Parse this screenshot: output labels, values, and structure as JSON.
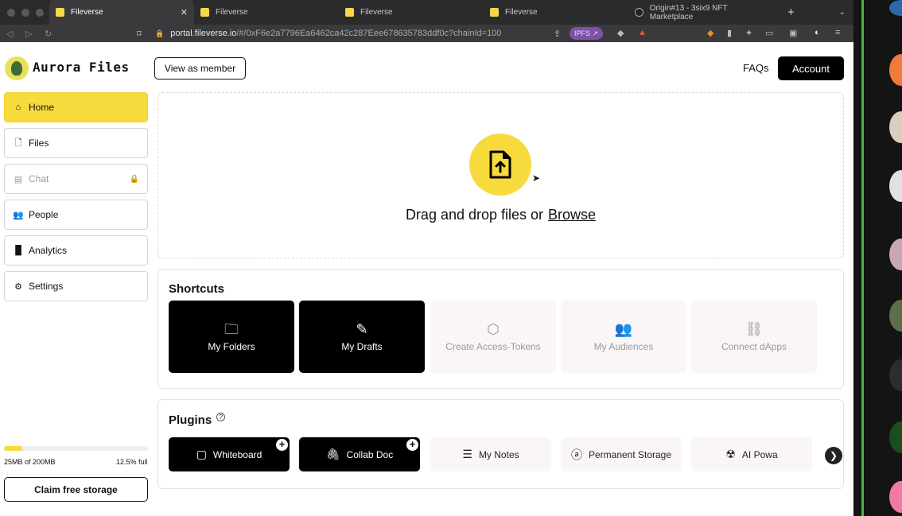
{
  "browser": {
    "tabs": [
      {
        "title": "Fileverse",
        "active": true
      },
      {
        "title": "Fileverse",
        "active": false
      },
      {
        "title": "Fileverse",
        "active": false
      },
      {
        "title": "Fileverse",
        "active": false
      },
      {
        "title": "Origin#13 - 3six9 NFT Marketplace",
        "active": false
      }
    ],
    "url_host": "portal.fileverse.io",
    "url_path": "/#/0xF6e2a7796Ea6462ca42c287Eee678635783ddf0c?chainId=100",
    "ipfs_label": "IPFS"
  },
  "header": {
    "brand": "Aurora Files",
    "view_as_member": "View as member",
    "faqs": "FAQs",
    "account": "Account"
  },
  "sidebar": {
    "items": [
      {
        "label": "Home",
        "icon": "home-icon",
        "active": true
      },
      {
        "label": "Files",
        "icon": "file-icon"
      },
      {
        "label": "Chat",
        "icon": "chat-icon",
        "locked": true
      },
      {
        "label": "People",
        "icon": "people-icon"
      },
      {
        "label": "Analytics",
        "icon": "bar-chart-icon"
      },
      {
        "label": "Settings",
        "icon": "gear-icon"
      }
    ],
    "storage": {
      "used": "25MB of 200MB",
      "percent": "12.5% full",
      "fill_fraction": 0.125
    },
    "claim": "Claim free storage"
  },
  "upload": {
    "text": "Drag and drop files or",
    "browse": "Browse"
  },
  "shortcuts": {
    "title": "Shortcuts",
    "items": [
      {
        "label": "My Folders",
        "icon": "folder-icon",
        "style": "dark"
      },
      {
        "label": "My Drafts",
        "icon": "edit-icon",
        "style": "dark"
      },
      {
        "label": "Create Access-Tokens",
        "icon": "cube-icon",
        "style": "light"
      },
      {
        "label": "My Audiences",
        "icon": "group-icon",
        "style": "light"
      },
      {
        "label": "Connect dApps",
        "icon": "link-icon",
        "style": "light"
      }
    ]
  },
  "plugins": {
    "title": "Plugins",
    "items": [
      {
        "label": "Whiteboard",
        "icon": "whiteboard-icon",
        "style": "dark"
      },
      {
        "label": "Collab Doc",
        "icon": "paperclip-icon",
        "style": "dark"
      },
      {
        "label": "My Notes",
        "icon": "lines-icon",
        "style": "light"
      },
      {
        "label": "Permanent Storage",
        "icon": "at-icon",
        "style": "light"
      },
      {
        "label": "AI Powa",
        "icon": "ai-icon",
        "style": "light"
      }
    ]
  },
  "colors": {
    "accent": "#f7db3d",
    "dark": "#000000",
    "light_card": "#faf6f8"
  }
}
